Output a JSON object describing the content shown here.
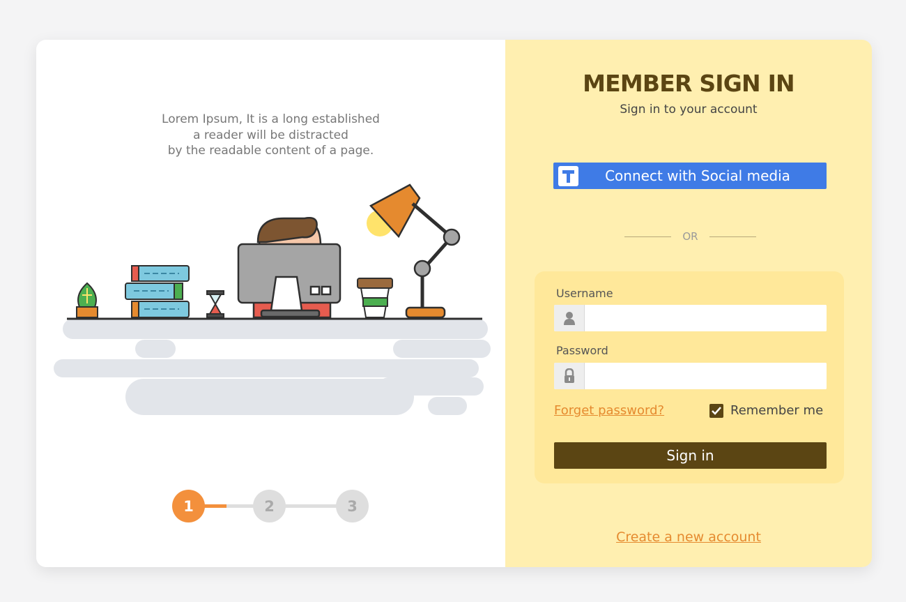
{
  "intro": {
    "lines": [
      "Lorem Ipsum, It is a long established",
      "a reader will be distracted",
      "by the readable content of a page."
    ]
  },
  "stepper": {
    "steps": [
      "1",
      "2",
      "3"
    ],
    "active_step": 1
  },
  "signin_panel": {
    "title": "MEMBER SIGN IN",
    "subtitle": "Sign in to your account",
    "social_button": "Connect with Social media",
    "divider": "OR",
    "username_label": "Username",
    "username_value": "",
    "password_label": "Password",
    "password_value": "",
    "forgot_link": "Forget password?",
    "remember_label": "Remember me",
    "remember_checked": true,
    "signin_button": "Sign in",
    "create_account_link": "Create a new account"
  },
  "colors": {
    "brand_dark": "#5b4513",
    "panel_background": "#ffefb0",
    "form_background": "#ffe89a",
    "accent_orange": "#f3903c",
    "link_orange": "#e58a2f",
    "social_blue": "#3f7be6"
  },
  "icons": {
    "social": "social-media-icon",
    "username": "user-icon",
    "password": "lock-icon",
    "remember": "checkmark-icon"
  }
}
